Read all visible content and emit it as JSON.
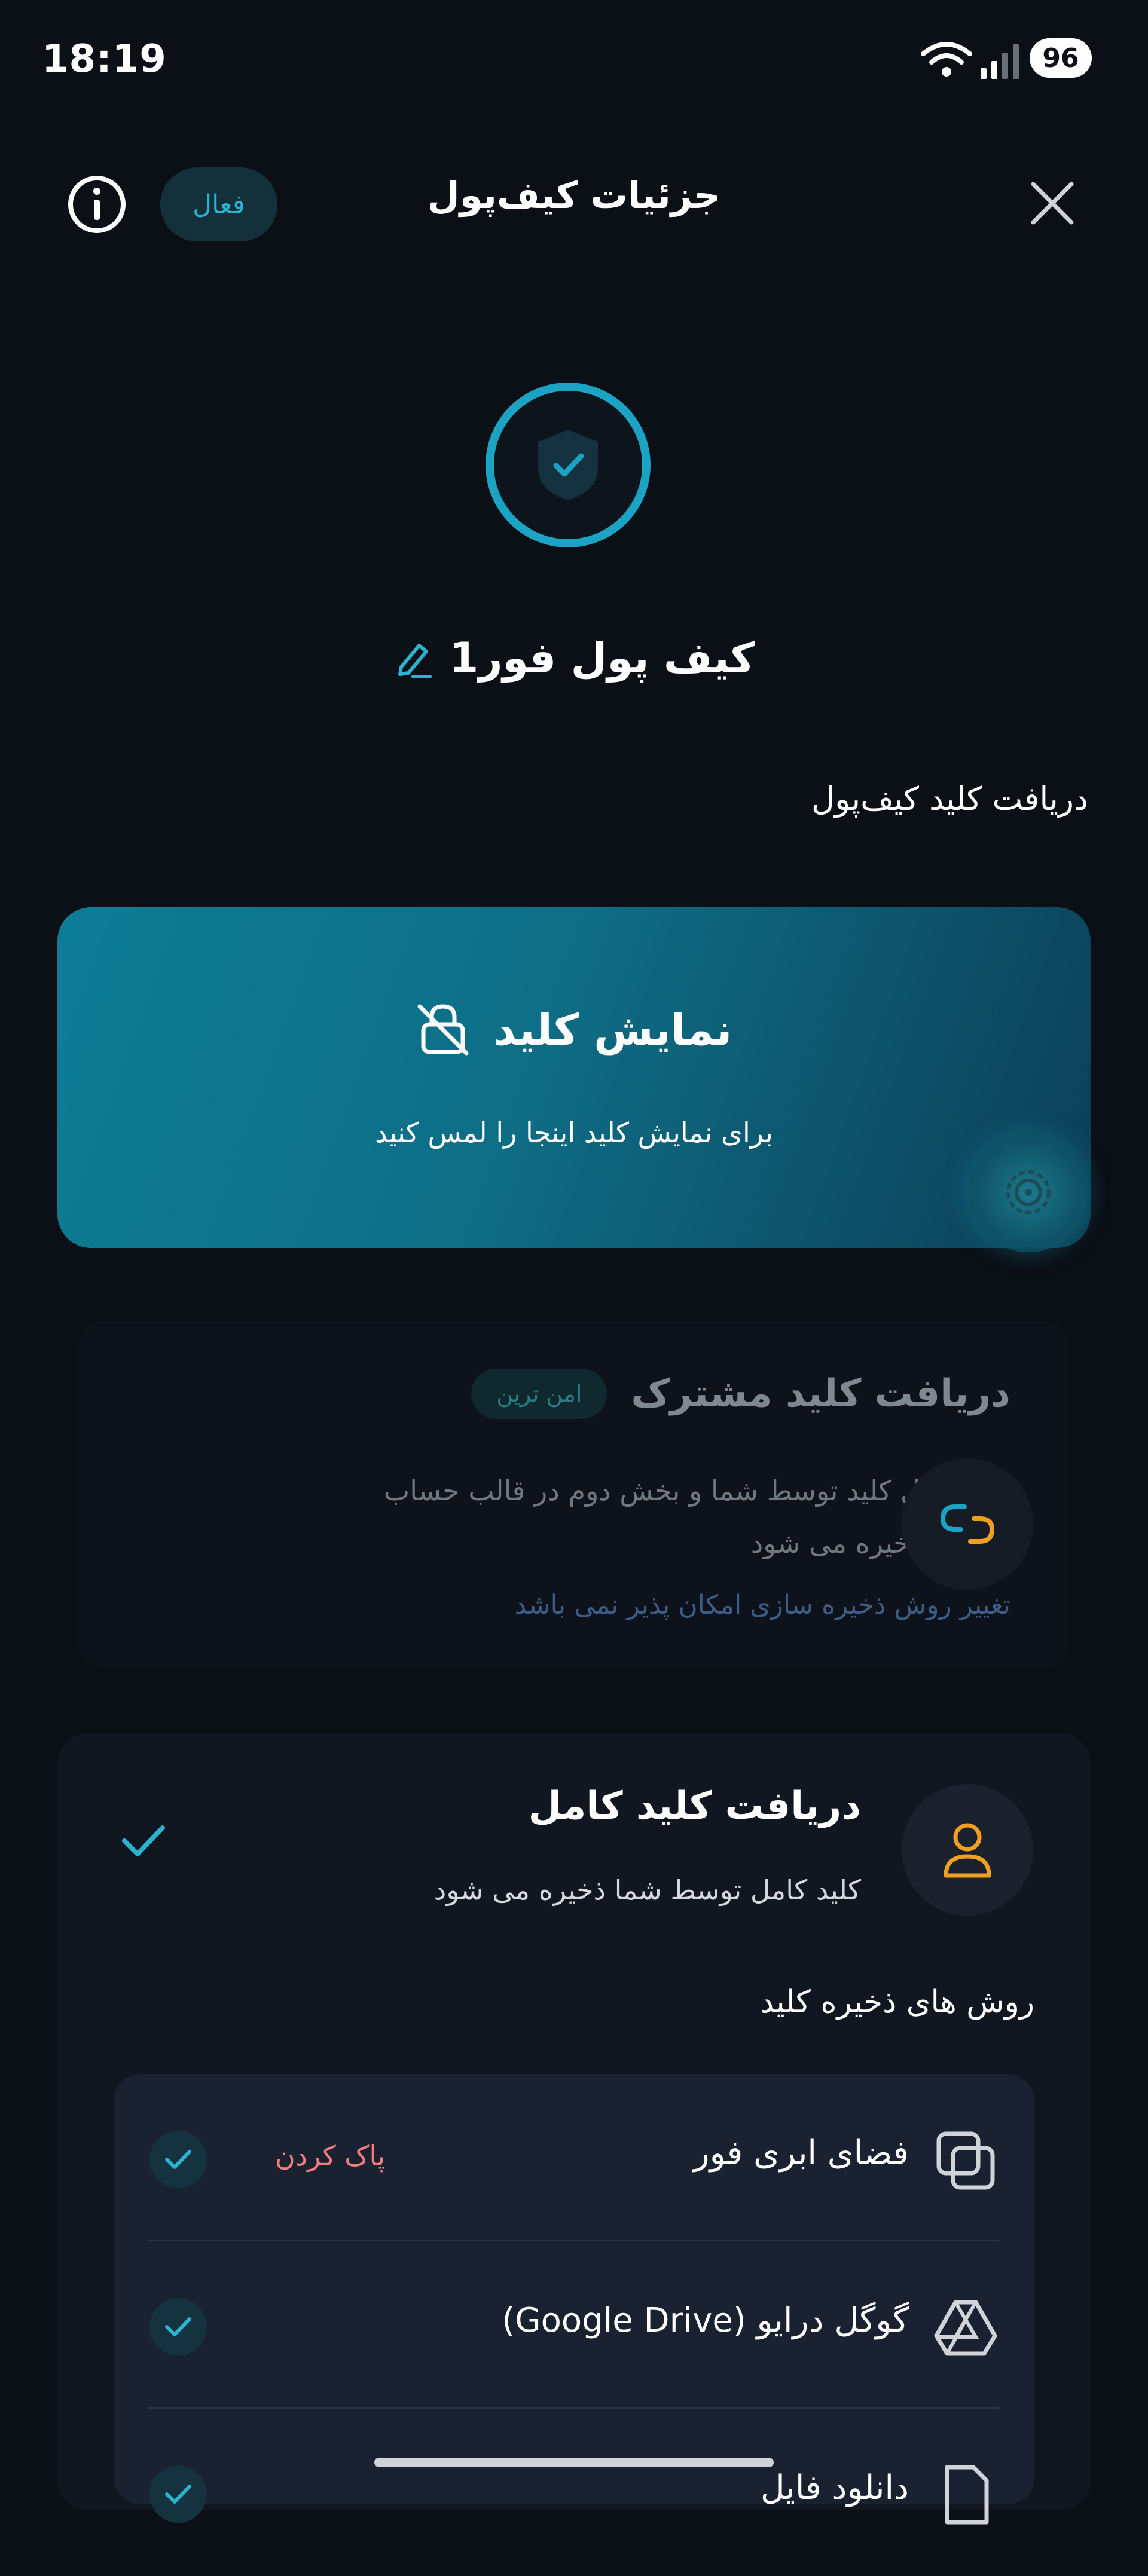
{
  "status_bar": {
    "time": "18:19",
    "battery": "96"
  },
  "header": {
    "title": "جزئیات کیف‌پول",
    "status_badge": "فعال"
  },
  "wallet": {
    "name": "کیف پول فور1"
  },
  "key_section": {
    "title": "دریافت کلید  کیف‌پول",
    "show_key": {
      "title": "نمایش کلید",
      "subtitle": "برای نمایش کلید اینجا را لمس کنید"
    },
    "shared_key": {
      "title": "دریافت کلید مشترک",
      "badge": "امن ترین",
      "description": "بخش اول کلید توسط شما و بخش دوم در قالب حساب کاربری ذخیره می شود",
      "note": "تغییر روش ذخیره سازی امکان پذیر نمی باشد"
    },
    "full_key": {
      "title": "دریافت کلید کامل",
      "description": "کلید کامل توسط شما ذخیره می شود"
    }
  },
  "storage_methods": {
    "title": "روش های ذخیره کلید",
    "items": [
      {
        "label": "فضای ابری فور",
        "action": "پاک کردن",
        "checked": true,
        "icon": "cloud-layers-icon"
      },
      {
        "label": "گوگل درایو (Google Drive)",
        "action": "",
        "checked": true,
        "icon": "google-drive-icon"
      },
      {
        "label": "دانلود فایل",
        "action": "",
        "checked": true,
        "icon": "file-icon"
      }
    ]
  },
  "colors": {
    "background": "#0b0f16",
    "accent": "#1aa3c2",
    "warning": "#f07e7e",
    "orange": "#f0a020"
  }
}
